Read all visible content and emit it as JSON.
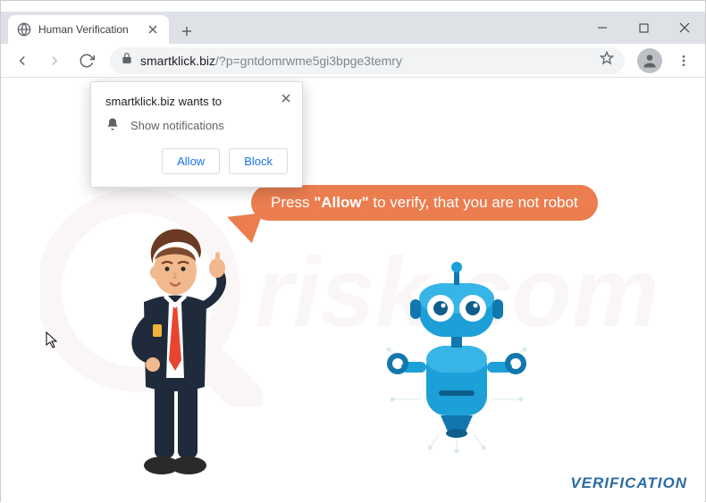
{
  "window": {
    "tab_title": "Human Verification",
    "minimize_tooltip": "Minimize",
    "maximize_tooltip": "Maximize",
    "close_tooltip": "Close"
  },
  "toolbar": {
    "url_domain": "smartklick.biz",
    "url_path": "/?p=gntdomrwme5gi3bpge3temry"
  },
  "permission": {
    "origin_text": "smartklick.biz wants to",
    "capability": "Show notifications",
    "allow_label": "Allow",
    "block_label": "Block"
  },
  "page": {
    "bubble_prefix": "Press ",
    "bubble_quote": "\"Allow\"",
    "bubble_suffix": " to verify, that you are not robot",
    "footer": "VERIFICATION"
  },
  "colors": {
    "bubble": "#eb7d4f",
    "link_blue": "#1a73e8",
    "robot_blue": "#1da0d8",
    "robot_dark": "#1177ae",
    "footer_blue": "#2b6ca3"
  }
}
